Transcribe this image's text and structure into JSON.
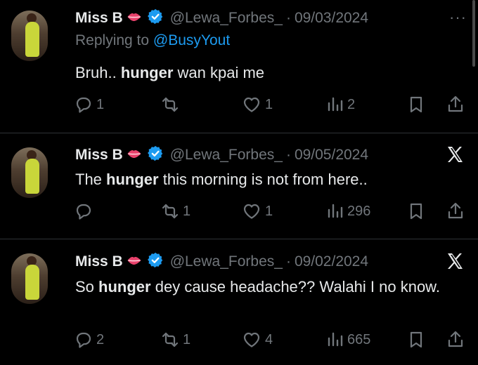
{
  "tweets": [
    {
      "name": "Miss B",
      "handle": "@Lewa_Forbes_",
      "sep": "·",
      "date": "09/03/2024",
      "reply_prefix": "Replying to",
      "reply_mention": "@BusyYout",
      "text_before": "Bruh..",
      "text_bold": "hunger",
      "text_after": "wan kpai me",
      "replies": "1",
      "reposts": "",
      "likes": "1",
      "views": "2",
      "corner_icon": "more-icon",
      "more_glyph": "···"
    },
    {
      "name": "Miss B",
      "handle": "@Lewa_Forbes_",
      "sep": "·",
      "date": "09/05/2024",
      "text_before": "The",
      "text_bold": "hunger",
      "text_after": "this morning is not from here..",
      "replies": "",
      "reposts": "1",
      "likes": "1",
      "views": "296",
      "corner_icon": "x-logo-icon"
    },
    {
      "name": "Miss B",
      "handle": "@Lewa_Forbes_",
      "sep": "·",
      "date": "09/02/2024",
      "text_before": "So",
      "text_bold": "hunger",
      "text_after": "dey cause headache?? Walahi I no know.",
      "replies": "2",
      "reposts": "1",
      "likes": "4",
      "views": "665",
      "corner_icon": "x-logo-icon"
    }
  ],
  "colors": {
    "background": "#000000",
    "text": "#e7e9ea",
    "muted": "#71767b",
    "link": "#1d9bf0",
    "verified": "#1d9bf0",
    "divider": "#2f3336"
  }
}
